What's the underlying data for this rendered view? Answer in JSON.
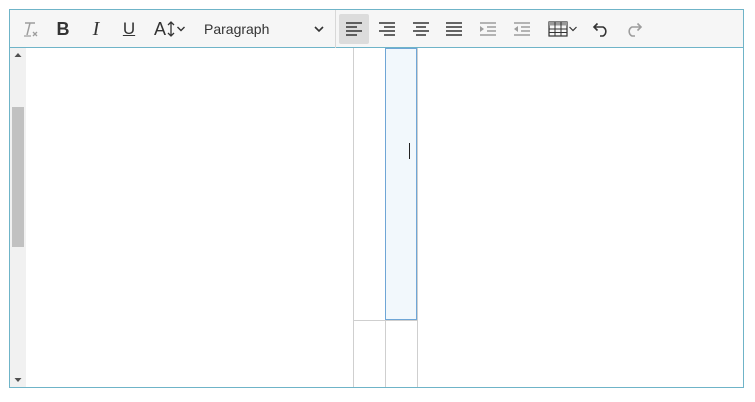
{
  "toolbar": {
    "clear_format": {
      "icon": "clear-formatting-icon"
    },
    "bold": {
      "icon": "bold-icon",
      "label": "B"
    },
    "italic": {
      "icon": "italic-icon",
      "label": "I"
    },
    "underline": {
      "icon": "underline-icon",
      "label": "U"
    },
    "font_size": {
      "icon": "font-size-icon",
      "label": "A"
    },
    "format_select": {
      "value": "Paragraph",
      "icon": "chevron-down-icon"
    },
    "align_left": {
      "icon": "align-left-icon",
      "active": true
    },
    "align_right": {
      "icon": "align-right-icon"
    },
    "align_center": {
      "icon": "align-center-icon"
    },
    "align_justify": {
      "icon": "align-justify-icon"
    },
    "indent": {
      "icon": "indent-icon",
      "disabled": true
    },
    "outdent": {
      "icon": "outdent-icon",
      "disabled": true
    },
    "table": {
      "icon": "table-icon"
    },
    "undo": {
      "icon": "undo-icon"
    },
    "redo": {
      "icon": "redo-icon",
      "disabled": true
    }
  },
  "colors": {
    "border_accent": "#6fb4c8",
    "toolbar_bg": "#f6f6f6",
    "active_bg": "#dcdcdc",
    "selected_cell_bg": "#f2f8fc",
    "selected_cell_border": "#6fa6d6"
  }
}
